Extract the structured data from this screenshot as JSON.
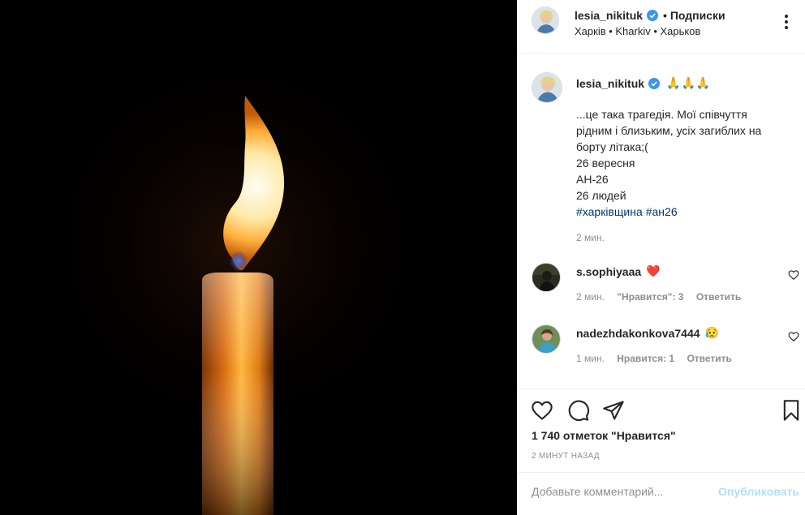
{
  "post": {
    "image_alt": "candle",
    "author": {
      "username": "lesia_nikituk",
      "verified": true,
      "follow_label": "• Подписки",
      "location": "Харків • Kharkiv • Харьков"
    },
    "caption": {
      "username": "lesia_nikituk",
      "emoji": "🙏🙏🙏",
      "lines": [
        "...це така трагедія. Мої співчуття",
        "рідним і близьким, усіх загиблих на",
        "борту літака;(",
        "26 вересня",
        "АН-26",
        "26 людей"
      ],
      "hashtags": [
        "#харківщина",
        "#ан26"
      ],
      "time": "2 мин."
    },
    "comments": [
      {
        "username": "s.sophiyaaa",
        "emoji": "❤️",
        "time": "2 мин.",
        "likes": "\"Нравится\": 3",
        "reply": "Ответить"
      },
      {
        "username": "nadezhdakonkova7444",
        "emoji": "😥",
        "time": "1 мин.",
        "likes": "Нравится: 1",
        "reply": "Ответить"
      }
    ],
    "likes_count": "1 740 отметок \"Нравится\"",
    "time_ago": "2 минут назад",
    "add_comment": {
      "placeholder": "Добавьте комментарий...",
      "publish_label": "Опубликовать"
    },
    "icons": {
      "like": "heart-icon",
      "comment": "comment-icon",
      "share": "send-icon",
      "save": "bookmark-icon",
      "more": "more-icon",
      "verified": "verified-badge-icon"
    },
    "colors": {
      "link": "#00376b",
      "publish_disabled": "#b2dffc",
      "verified": "#3897f0",
      "secondary_text": "#8e8e8e"
    }
  }
}
